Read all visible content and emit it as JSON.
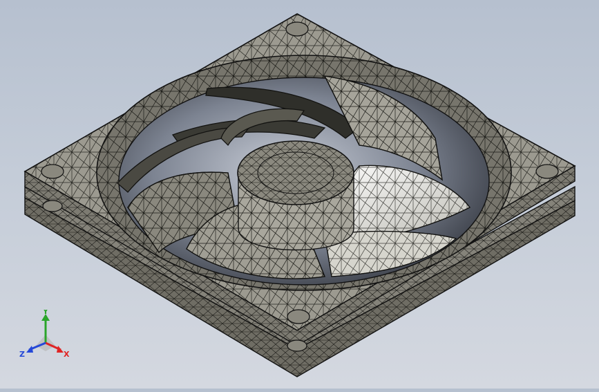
{
  "viewport": {
    "background_top": "#b6c0cf",
    "background_bottom": "#d4d8e0",
    "model": "fan-wireframe-mesh",
    "model_fill": "#8e8c82",
    "model_edge": "#151512",
    "blade_highlight": "#f2f2ee"
  },
  "triad": {
    "x_label": "X",
    "y_label": "Y",
    "z_label": "Z",
    "x_color": "#e02424",
    "y_color": "#2aa52a",
    "z_color": "#2448d8"
  }
}
